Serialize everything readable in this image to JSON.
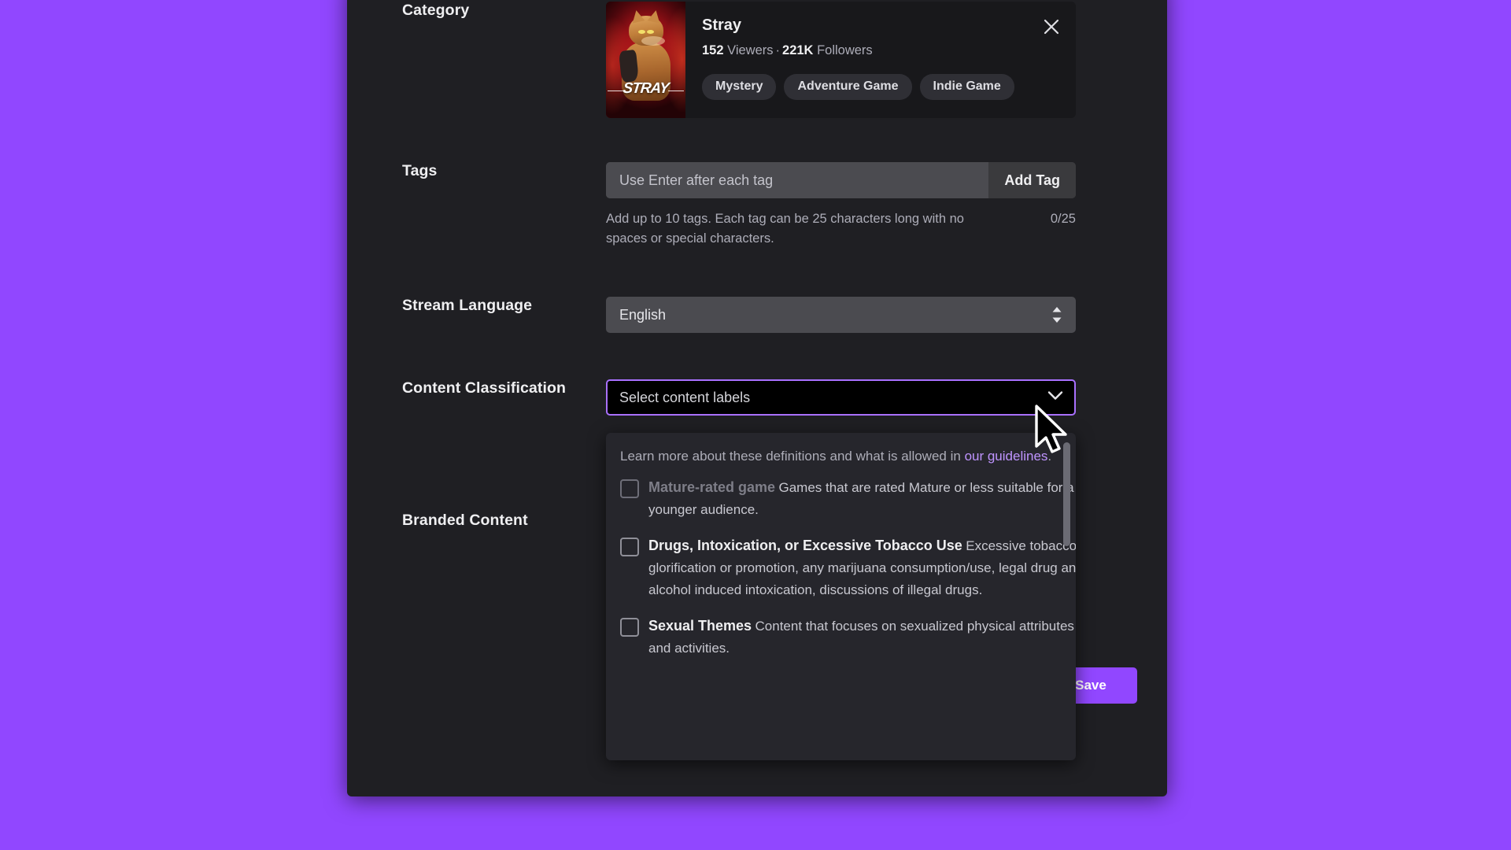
{
  "category": {
    "label": "Category",
    "name": "Stray",
    "viewers_count": "152",
    "viewers_word": "Viewers",
    "separator": "·",
    "followers_count": "221K",
    "followers_word": "Followers",
    "boxart_title": "STRAY",
    "tags": [
      "Mystery",
      "Adventure Game",
      "Indie Game"
    ],
    "close_icon": "close-icon"
  },
  "tags": {
    "label": "Tags",
    "input_value": "",
    "placeholder": "Use Enter after each tag",
    "add_button": "Add Tag",
    "helper": "Add up to 10 tags. Each tag can be 25 characters long with no spaces or special characters.",
    "counter": "0/25"
  },
  "language": {
    "label": "Stream Language",
    "value": "English",
    "stepper_icon": "up-down-stepper-icon"
  },
  "classification": {
    "label": "Content Classification",
    "placeholder": "Select content labels",
    "chevron_icon": "chevron-down-icon",
    "accent_color": "#a970ff",
    "dropdown": {
      "note_prefix": "Learn more about these definitions and what is allowed in ",
      "note_link": "our guidelines",
      "note_suffix": ".",
      "items": [
        {
          "title": "Mature-rated game",
          "description": "Games that are rated Mature or less suitable for a younger audience.",
          "checked": false,
          "disabled": true
        },
        {
          "title": "Drugs, Intoxication, or Excessive Tobacco Use",
          "description": "Excessive tobacco glorification or promotion, any marijuana consumption/use, legal drug and alcohol induced intoxication, discussions of illegal drugs.",
          "checked": false,
          "disabled": false
        },
        {
          "title": "Sexual Themes",
          "description": "Content that focuses on sexualized physical attributes and activities.",
          "checked": false,
          "disabled": false
        }
      ]
    }
  },
  "branded": {
    "label": "Branded Content"
  },
  "footer": {
    "save_label": "Save"
  },
  "colors": {
    "page_background": "#9147ff",
    "modal_background": "#1f1f23",
    "accent": "#9147ff",
    "link": "#bf94ff"
  }
}
